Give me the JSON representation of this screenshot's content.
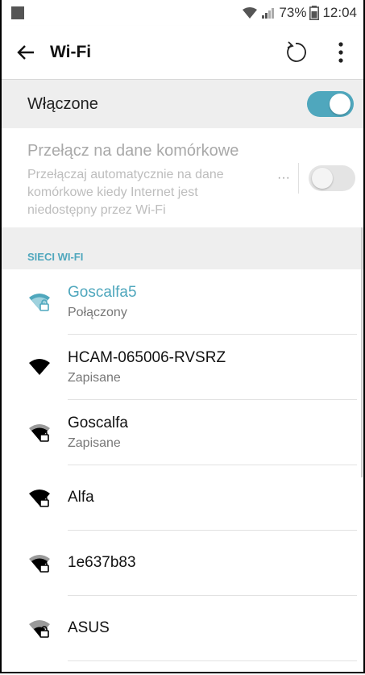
{
  "status_bar": {
    "battery": "73%",
    "time": "12:04"
  },
  "app_bar": {
    "title": "Wi-Fi",
    "back_icon": "arrow-left-icon",
    "refresh_icon": "refresh-icon",
    "menu_icon": "more-vert-icon"
  },
  "master": {
    "label": "Włączone",
    "enabled": true
  },
  "fallback": {
    "title": "Przełącz na dane komórkowe",
    "description": "Przełączaj automatycznie na dane komórkowe kiedy Internet jest niedostępny przez Wi-Fi",
    "more": "···",
    "enabled": false
  },
  "section": {
    "label": "SIECI WI-FI"
  },
  "networks": [
    {
      "name": "Goscalfa5",
      "status": "Połączony",
      "connected": true,
      "secured": true
    },
    {
      "name": "HCAM-065006-RVSRZ",
      "status": "Zapisane",
      "connected": false,
      "secured": false
    },
    {
      "name": "Goscalfa",
      "status": "Zapisane",
      "connected": false,
      "secured": true
    },
    {
      "name": "Alfa",
      "status": "",
      "connected": false,
      "secured": true
    },
    {
      "name": "1e637b83",
      "status": "",
      "connected": false,
      "secured": true
    },
    {
      "name": "ASUS",
      "status": "",
      "connected": false,
      "secured": true
    }
  ],
  "colors": {
    "accent": "#4fa7bd"
  }
}
